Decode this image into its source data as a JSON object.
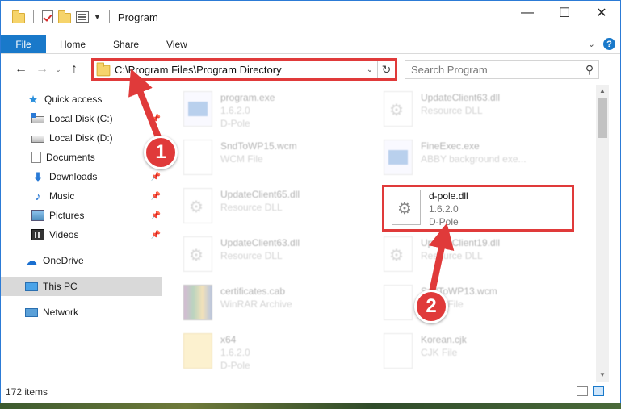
{
  "window": {
    "title": "Program",
    "controls": {
      "minimize": "—",
      "maximize": "☐",
      "close": "✕"
    }
  },
  "ribbon": {
    "file": "File",
    "tabs": [
      "Home",
      "Share",
      "View"
    ]
  },
  "nav": {
    "address": "C:\\Program Files\\Program Directory",
    "search_placeholder": "Search Program"
  },
  "sidebar": {
    "items": [
      {
        "label": "Quick access",
        "icon": "star-icon"
      },
      {
        "label": "Local Disk (C:)",
        "icon": "disk-icon"
      },
      {
        "label": "Local Disk (D:)",
        "icon": "disk-icon"
      },
      {
        "label": "Documents",
        "icon": "documents-icon"
      },
      {
        "label": "Downloads",
        "icon": "downloads-icon"
      },
      {
        "label": "Music",
        "icon": "music-icon"
      },
      {
        "label": "Pictures",
        "icon": "pictures-icon"
      },
      {
        "label": "Videos",
        "icon": "videos-icon"
      },
      {
        "label": "OneDrive",
        "icon": "onedrive-icon"
      },
      {
        "label": "This PC",
        "icon": "this-pc-icon"
      },
      {
        "label": "Network",
        "icon": "network-icon"
      }
    ]
  },
  "files": [
    {
      "name": "program.exe",
      "line2": "1.6.2.0",
      "line3": "D-Pole"
    },
    {
      "name": "UpdateClient63.dll",
      "line2": "Resource DLL",
      "line3": ""
    },
    {
      "name": "SndToWP15.wcm",
      "line2": "WCM File",
      "line3": ""
    },
    {
      "name": "FineExec.exe",
      "line2": "ABBY background exe...",
      "line3": ""
    },
    {
      "name": "UpdateClient65.dll",
      "line2": "Resource DLL",
      "line3": ""
    },
    {
      "name": "d-pole.dll",
      "line2": "1.6.2.0",
      "line3": "D-Pole"
    },
    {
      "name": "UpdateClient63.dll",
      "line2": "Resource DLL",
      "line3": ""
    },
    {
      "name": "UpdateClient19.dll",
      "line2": "Resource DLL",
      "line3": ""
    },
    {
      "name": "certificates.cab",
      "line2": "WinRAR Archive",
      "line3": ""
    },
    {
      "name": "SndToWP13.wcm",
      "line2": "WCM File",
      "line3": ""
    },
    {
      "name": "x64",
      "line2": "1.6.2.0",
      "line3": "D-Pole"
    },
    {
      "name": "Korean.cjk",
      "line2": "CJK File",
      "line3": ""
    }
  ],
  "status": {
    "items": "172 items"
  },
  "annotations": {
    "badge1": "1",
    "badge2": "2"
  },
  "colors": {
    "accent": "#1979ca",
    "highlight": "#e03a3a"
  }
}
